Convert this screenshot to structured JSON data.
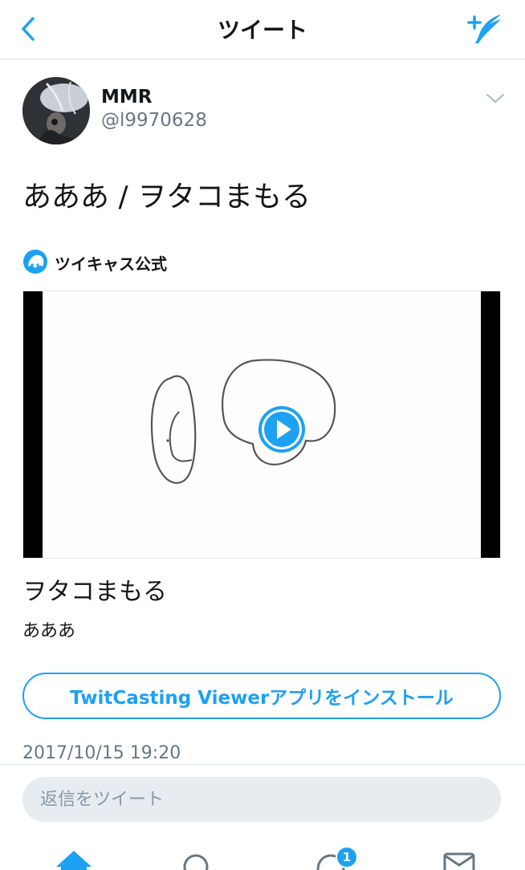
{
  "header": {
    "title": "ツイート",
    "back_icon": "chevron-left-icon",
    "compose_icon": "compose-tweet-icon",
    "accent_color": "#1da1f2"
  },
  "tweet": {
    "author_name": "MMR",
    "author_handle": "@l9970628",
    "text": "あああ / ヲタコまもる",
    "timestamp": "2017/10/15 19:20"
  },
  "card": {
    "source_name": "ツイキャス公式",
    "title": "ヲタコまもる",
    "description": "あああ",
    "install_button_label": "TwitCasting Viewerアプリをインストール"
  },
  "reply": {
    "placeholder": "返信をツイート"
  },
  "tabbar": {
    "tabs": [
      "home-icon",
      "search-icon",
      "notifications-icon",
      "messages-icon"
    ],
    "notifications_badge": "1"
  }
}
